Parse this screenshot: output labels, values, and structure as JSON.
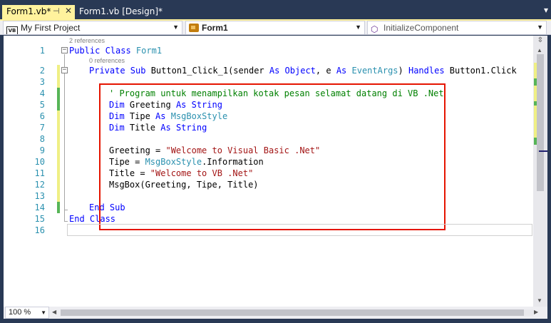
{
  "tabs": {
    "active_label": "Form1.vb*",
    "pin_glyph": "⊣",
    "close_glyph": "✕",
    "design_label": "Form1.vb [Design]*",
    "overflow_glyph": "▾"
  },
  "navbar": {
    "project_icon": "VB",
    "project": "My First Project",
    "class": "Form1",
    "member": "InitializeComponent",
    "dropdown_glyph": "▼"
  },
  "editor": {
    "line_numbers": [
      "1",
      "2",
      "3",
      "4",
      "5",
      "6",
      "7",
      "8",
      "9",
      "10",
      "11",
      "12",
      "13",
      "14",
      "15",
      "16"
    ],
    "refs_class": "2 references",
    "refs_sub": "0 references",
    "code": {
      "l1_kw": "Public Class ",
      "l1_ty": "Form1",
      "l2_kw1": "Private Sub ",
      "l2_t1": "Button1_Click_1(sender ",
      "l2_kw2": "As Object",
      "l2_t2": ", e ",
      "l2_kw3": "As ",
      "l2_ty": "EventArgs",
      "l2_t3": ") ",
      "l2_kw4": "Handles ",
      "l2_t4": "Button1.Click",
      "l4_cmt": "' Program untuk menampilkan kotak pesan selamat datang di VB .Net",
      "l5_kw1": "Dim ",
      "l5_t": "Greeting ",
      "l5_kw2": "As String",
      "l6_kw1": "Dim ",
      "l6_t": "Tipe ",
      "l6_kw2": "As ",
      "l6_ty": "MsgBoxStyle",
      "l7_kw1": "Dim ",
      "l7_t": "Title ",
      "l7_kw2": "As String",
      "l9_t": "Greeting = ",
      "l9_str": "\"Welcome to Visual Basic .Net\"",
      "l10_t1": "Tipe = ",
      "l10_ty": "MsgBoxStyle",
      "l10_t2": ".Information",
      "l11_t": "Title = ",
      "l11_str": "\"Welcome to VB .Net\"",
      "l12_t": "MsgBox(Greeting, Tipe, Title)",
      "l14_kw": "End Sub",
      "l15_kw": "End Class"
    },
    "outline_collapse": "−"
  },
  "scroll": {
    "split_glyph": "⇳",
    "up_glyph": "▲",
    "down_glyph": "▼",
    "left_glyph": "◀",
    "right_glyph": "▶"
  },
  "bottom": {
    "zoom": "100 %",
    "zoom_dd": "▼"
  },
  "colors": {
    "keyword": "#0000ff",
    "type": "#2b91af",
    "string": "#a31515",
    "comment": "#008000",
    "highlight_box": "#e51400",
    "active_tab": "#fff29d"
  }
}
